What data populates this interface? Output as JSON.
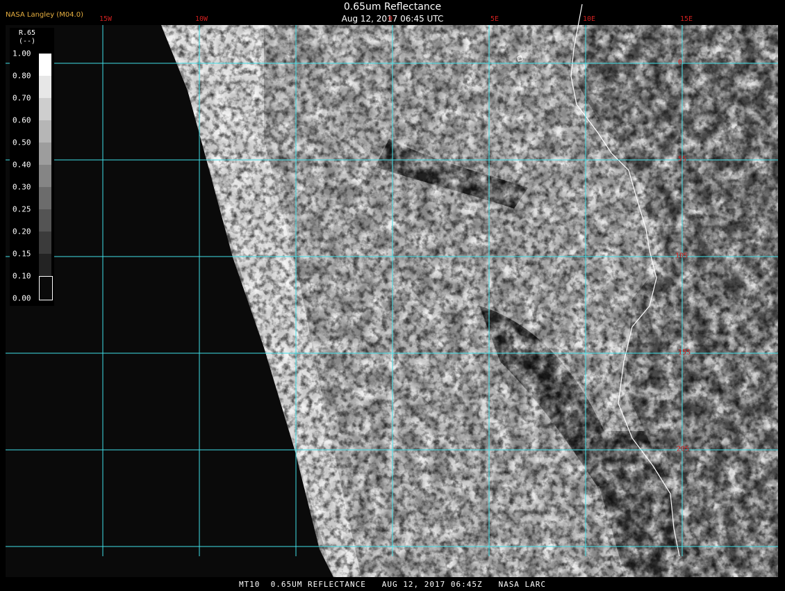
{
  "header": {
    "title": "0.65um Reflectance",
    "subtitle": "Aug 12, 2017 06:45 UTC",
    "agency": "NASA Langley (M04.0)"
  },
  "footer": {
    "caption": "MT10  0.65UM REFLECTANCE   AUG 12, 2017 06:45Z   NASA LARC"
  },
  "map": {
    "grid_color": "#40e0e8",
    "label_color": "#d02020",
    "coast_color": "#ffffff",
    "lon_labels": [
      "15W",
      "10W",
      "0",
      "5E",
      "10E",
      "15E"
    ],
    "lat_labels": [
      "0",
      "5S",
      "10S",
      "15S",
      "20S"
    ]
  },
  "legend": {
    "variable": "R.65",
    "unit": "(--)",
    "ticks": [
      "1.00",
      "0.80",
      "0.70",
      "0.60",
      "0.50",
      "0.40",
      "0.30",
      "0.25",
      "0.20",
      "0.15",
      "0.10",
      "0.00"
    ]
  }
}
